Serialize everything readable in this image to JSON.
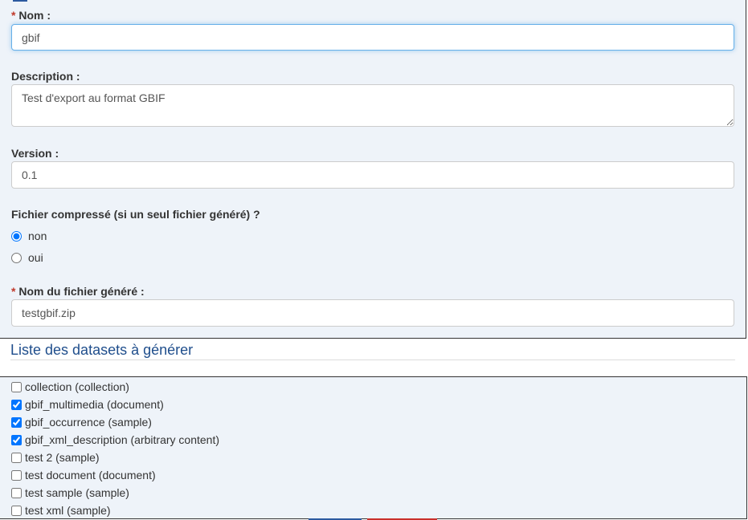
{
  "form": {
    "nom": {
      "required_mark": "*",
      "label": "Nom :",
      "value": "gbif"
    },
    "description": {
      "label": "Description :",
      "value": "Test d'export au format GBIF"
    },
    "version": {
      "label": "Version :",
      "value": "0.1"
    },
    "compress": {
      "label": "Fichier compressé (si un seul fichier généré) ?",
      "options": [
        {
          "label": "non",
          "checked": true
        },
        {
          "label": "oui",
          "checked": false
        }
      ]
    },
    "filename": {
      "required_mark": "*",
      "label": "Nom du fichier généré :",
      "value": "testgbif.zip"
    }
  },
  "datasets": {
    "title": "Liste des datasets à générer",
    "items": [
      {
        "label": "collection (collection)",
        "checked": false
      },
      {
        "label": "gbif_multimedia (document)",
        "checked": true
      },
      {
        "label": "gbif_occurrence (sample)",
        "checked": true
      },
      {
        "label": "gbif_xml_description (arbitrary content)",
        "checked": true
      },
      {
        "label": "test 2 (sample)",
        "checked": false
      },
      {
        "label": "test document (document)",
        "checked": false
      },
      {
        "label": "test sample (sample)",
        "checked": false
      },
      {
        "label": "test xml (sample)",
        "checked": false
      }
    ]
  },
  "colors": {
    "panel_bg": "#eef3f9",
    "required": "#c0392b",
    "section_title": "#1f4e8c",
    "primary_button": "#2c5aa0",
    "danger_button": "#c9302c"
  }
}
